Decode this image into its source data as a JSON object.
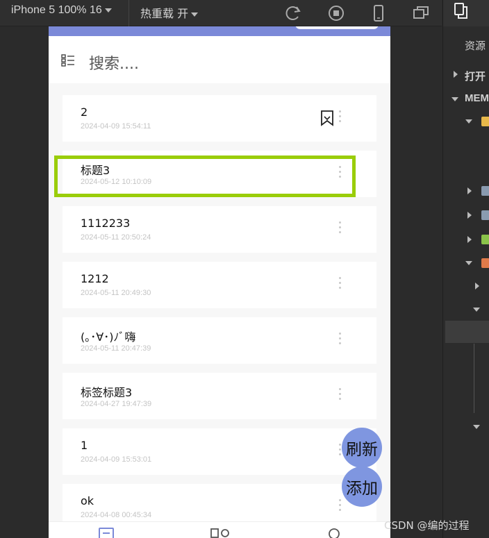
{
  "toolbar": {
    "device_label": "iPhone 5 100% 16",
    "hot_reload_label": "热重载 开",
    "icons": [
      "refresh-icon",
      "stop-icon",
      "phone-icon",
      "window-icon"
    ]
  },
  "right_panel": {
    "header_icon": "copy-icon",
    "resources_label": "资源",
    "open_label": "打开",
    "mem_label": "MEM"
  },
  "simulator": {
    "accent": "#7b89d8",
    "search_placeholder": "搜索....",
    "notes": [
      {
        "title": "2",
        "date": "2024-04-09 15:54:11",
        "bookmarked": true
      },
      {
        "title": "标题3",
        "date": "2024-05-12 10:10:09",
        "bookmarked": false
      },
      {
        "title": "1112233",
        "date": "2024-05-11 20:50:24",
        "bookmarked": false
      },
      {
        "title": "1212",
        "date": "2024-05-11 20:49:30",
        "bookmarked": false
      },
      {
        "title": "(｡･∀･)ﾉﾞ嗨",
        "date": "2024-05-11 20:47:39",
        "bookmarked": false
      },
      {
        "title": "标签标题3",
        "date": "2024-04-27 19:47:39",
        "bookmarked": false
      },
      {
        "title": "1",
        "date": "2024-04-09 15:53:01",
        "bookmarked": false
      },
      {
        "title": "ok",
        "date": "2024-04-08 00:45:34",
        "bookmarked": false
      }
    ],
    "refresh_button": "刷新",
    "add_button": "添加"
  },
  "watermark": "CSDN @编的过程",
  "colors": {
    "highlight": "#9acd0a",
    "fab": "#7f96e0"
  }
}
